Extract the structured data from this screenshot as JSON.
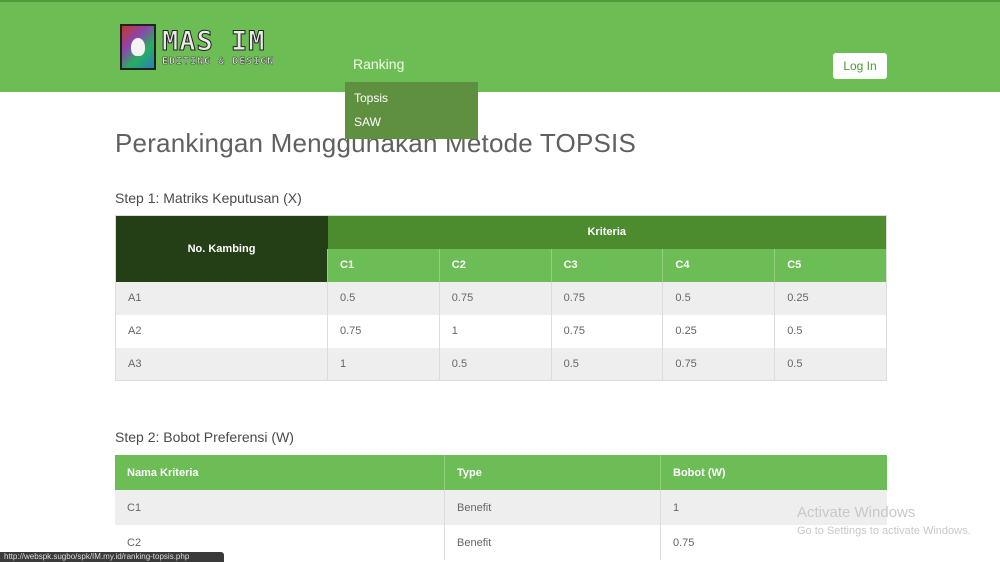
{
  "header": {
    "logo_title": "MAS IM",
    "logo_subtitle": "EDITING & DESIGN",
    "nav_ranking": "Ranking",
    "login_label": "Log In",
    "accent_color": "#6dbd55"
  },
  "dropdown": {
    "items": [
      {
        "label": "Topsis"
      },
      {
        "label": "SAW"
      }
    ]
  },
  "page": {
    "title": "Perankingan Menggunakan Metode TOPSIS"
  },
  "step1": {
    "title": "Step 1: Matriks Keputusan (X)",
    "header_no": "No. Kambing",
    "header_kriteria": "Kriteria",
    "criteria": [
      "C1",
      "C2",
      "C3",
      "C4",
      "C5"
    ],
    "rows": [
      {
        "name": "A1",
        "values": [
          "0.5",
          "0.75",
          "0.75",
          "0.5",
          "0.25"
        ]
      },
      {
        "name": "A2",
        "values": [
          "0.75",
          "1",
          "0.75",
          "0.25",
          "0.5"
        ]
      },
      {
        "name": "A3",
        "values": [
          "1",
          "0.5",
          "0.5",
          "0.75",
          "0.5"
        ]
      }
    ]
  },
  "step2": {
    "title": "Step 2: Bobot Preferensi (W)",
    "headers": [
      "Nama Kriteria",
      "Type",
      "Bobot (W)"
    ],
    "rows": [
      {
        "values": [
          "C1",
          "Benefit",
          "1"
        ]
      },
      {
        "values": [
          "C2",
          "Benefit",
          "0.75"
        ]
      }
    ]
  },
  "watermark": {
    "line1": "Activate Windows",
    "line2": "Go to Settings to activate Windows."
  },
  "statusbar": {
    "url": "http://webspk.sugbo/spk/IM.my.id/ranking-topsis.php"
  }
}
